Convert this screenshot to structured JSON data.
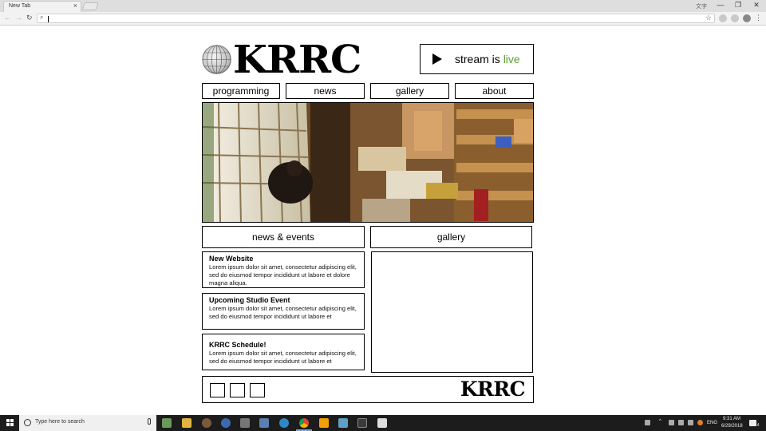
{
  "browser": {
    "tab_title": "New Tab",
    "tab_close": "×",
    "user_label": "文字",
    "window_buttons": [
      "—",
      "❐",
      "✕"
    ],
    "nav_icons": [
      "←",
      "→",
      "↻"
    ],
    "omnibox_value": "",
    "search_glyph": "⌕",
    "star_glyph": "☆",
    "menu_glyph": "⋮"
  },
  "site": {
    "logo": "KRRC",
    "stream": {
      "prefix": "stream is ",
      "status": "live",
      "status_color": "#5aa02c"
    },
    "nav": [
      "programming",
      "news",
      "gallery",
      "about"
    ],
    "sections": {
      "news": "news & events",
      "gallery": "gallery"
    },
    "news_items": [
      {
        "title": "New Website",
        "body": "Lorem ipsum dolor sit amet, consectetur adipiscing elit, sed do eiusmod tempor incididunt ut labore et dolore magna aliqua."
      },
      {
        "title": "Upcoming Studio Event",
        "body": "Lorem ipsum dolor sit amet, consectetur adipiscing elit, sed do eiusmod tempor incididunt ut labore et"
      },
      {
        "title": "KRRC Schedule!",
        "body": "Lorem ipsum dolor sit amet, consectetur adipiscing elit, sed do eiusmod tempor incididunt ut labore et"
      }
    ],
    "footer_logo": "KRRC",
    "social_icons": [
      "social-icon-1",
      "social-icon-2",
      "social-icon-3"
    ]
  },
  "taskbar": {
    "search_placeholder": "Type here to search",
    "lang": "ENG",
    "time": "9:31 AM",
    "date": "6/29/2018",
    "notification_count": "14"
  }
}
